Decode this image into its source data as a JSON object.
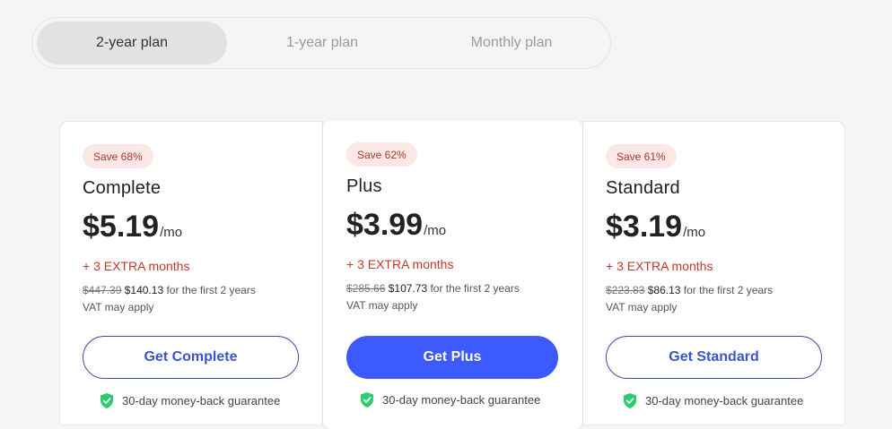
{
  "toggle": {
    "options": [
      "2-year plan",
      "1-year plan",
      "Monthly plan"
    ],
    "selected": "2-year plan"
  },
  "plans": [
    {
      "badge": "Save 68%",
      "name": "Complete",
      "price": "$5.19",
      "unit": "/mo",
      "extra": "+ 3 EXTRA months",
      "old_price": "$447.39",
      "new_price": "$140.13",
      "period": "for the first 2 years",
      "vat": "VAT may apply",
      "button": "Get Complete",
      "guarantee": "30-day money-back guarantee"
    },
    {
      "badge": "Save 62%",
      "name": "Plus",
      "price": "$3.99",
      "unit": "/mo",
      "extra": "+ 3 EXTRA months",
      "old_price": "$285.66",
      "new_price": "$107.73",
      "period": "for the first 2 years",
      "vat": "VAT may apply",
      "button": "Get Plus",
      "guarantee": "30-day money-back guarantee"
    },
    {
      "badge": "Save 61%",
      "name": "Standard",
      "price": "$3.19",
      "unit": "/mo",
      "extra": "+ 3 EXTRA months",
      "old_price": "$223.83",
      "new_price": "$86.13",
      "period": "for the first 2 years",
      "vat": "VAT may apply",
      "button": "Get Standard",
      "guarantee": "30-day money-back guarantee"
    }
  ],
  "colors": {
    "accent": "#3d5afe",
    "badge_bg": "#fbe7e5",
    "badge_text": "#b3362a",
    "extra_text": "#c0392b",
    "shield": "#2ecc71"
  },
  "icons": {
    "guarantee": "shield-check-icon"
  }
}
